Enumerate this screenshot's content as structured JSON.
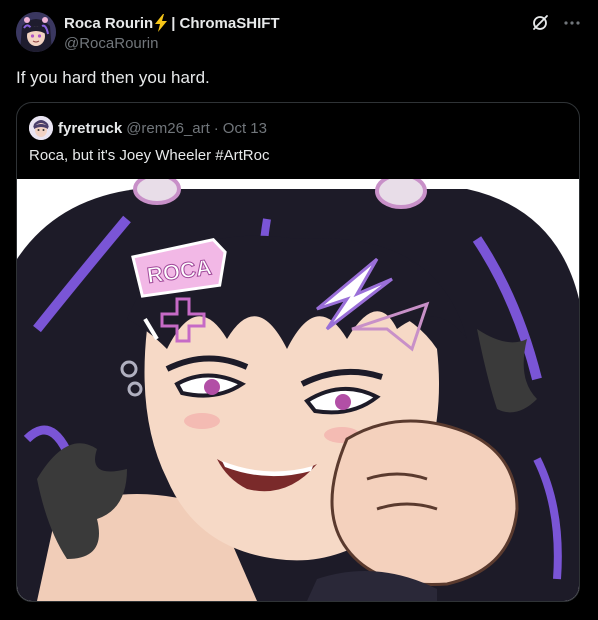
{
  "post": {
    "author_name": "Roca Rourin",
    "author_suffix": "| ChromaSHIFT",
    "author_handle": "@RocaRourin",
    "text": "If you hard then you hard."
  },
  "icons": {
    "name_emoji": "lightning-bolt-icon",
    "grok": "grok-icon",
    "more": "more-dots-icon"
  },
  "quote": {
    "author_name": "fyretruck",
    "author_handle": "@rem26_art",
    "separator": "·",
    "date": "Oct 13",
    "text": "Roca, but it's Joey Wheeler #ArtRoc",
    "art_lettering": "ROCA"
  },
  "colors": {
    "background": "#000000",
    "text_primary": "#e7e9ea",
    "text_secondary": "#71767b",
    "border": "#2f3336",
    "bolt": "#f5c518",
    "hair": "#1d1b28",
    "hair_accent": "#7a55d6",
    "skin": "#f6d9c6"
  }
}
